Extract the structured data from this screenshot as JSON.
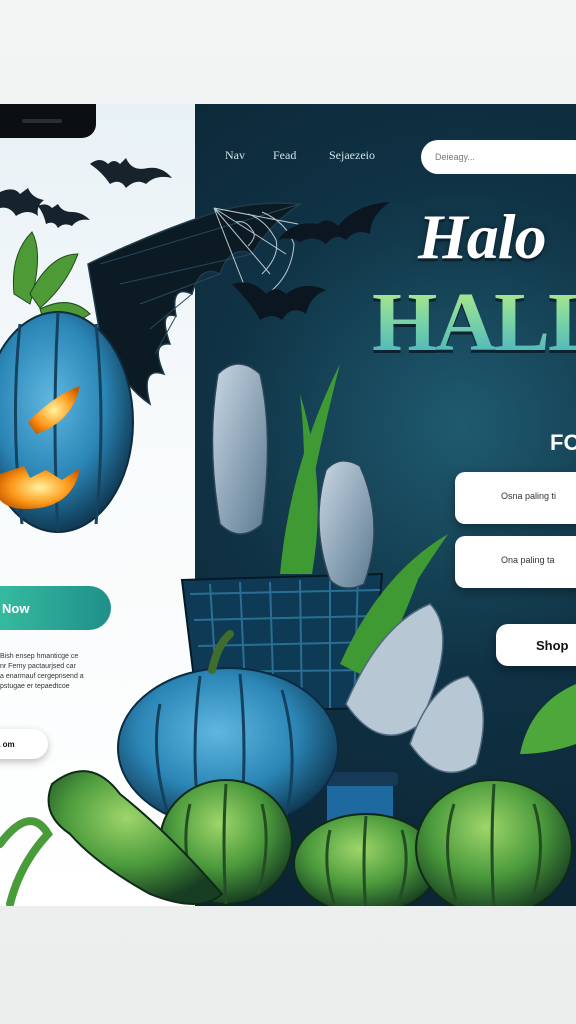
{
  "nav": {
    "items": [
      "Nav",
      "Fead",
      "Sejaezeio"
    ]
  },
  "search": {
    "placeholder": "Deieagy..."
  },
  "hero": {
    "title_line1": "Halo",
    "title_line2": "HALLO",
    "subtitle": "FO"
  },
  "cards": [
    {
      "text": "Osna paling ti"
    },
    {
      "text": "Ona paling ta"
    }
  ],
  "shop_button": {
    "label": "Shop"
  },
  "left": {
    "cta_label": "Now",
    "paragraph_lines": [
      "Bish ensep hmanticge ce",
      "nr Ferny pactaurjsed car",
      "a enarmauf cergepnsend a",
      "pstugae er tepaedtcoe"
    ],
    "small_button_label": "a om"
  },
  "colors": {
    "accent_teal": "#2fb79f",
    "dark_bg": "#0f3244",
    "pumpkin_blue": "#2b86b6",
    "leaf_green": "#5fb53a"
  },
  "icons": [
    "bat-icon",
    "jack-o-lantern-icon",
    "spiderweb-icon",
    "basket-icon",
    "pumpkin-icon",
    "corn-icon",
    "bread-icon"
  ]
}
